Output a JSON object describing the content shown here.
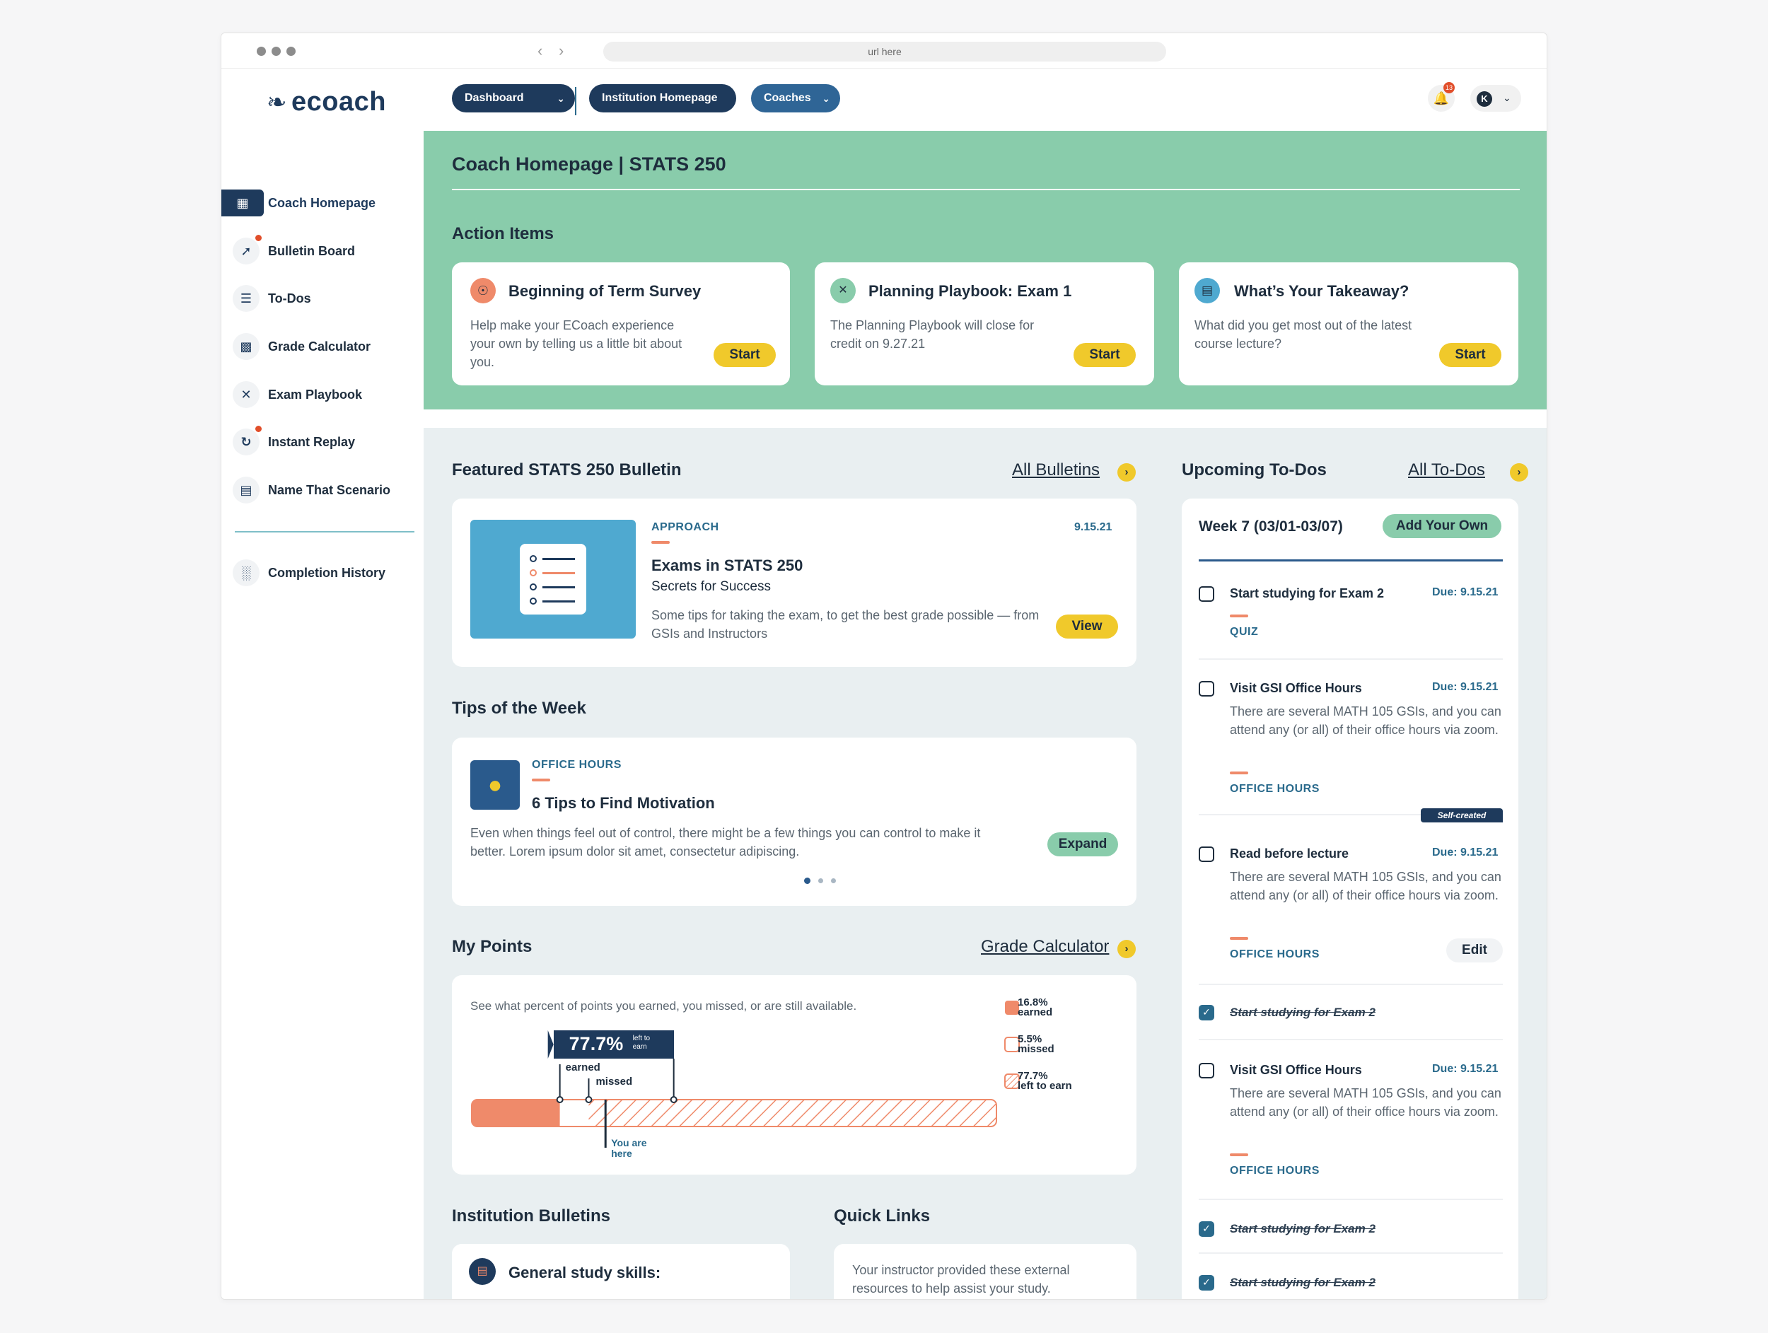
{
  "browser": {
    "url": "url here"
  },
  "logo": {
    "text": "ecoach"
  },
  "nav": {
    "dashboard": "Dashboard",
    "institution": "Institution Homepage",
    "coaches": "Coaches",
    "notification_count": "13",
    "user_initial": "K"
  },
  "sidebar": {
    "items": [
      {
        "label": "Coach Homepage",
        "icon": "dashboard-icon"
      },
      {
        "label": "Bulletin Board",
        "icon": "pin-icon"
      },
      {
        "label": "To-Dos",
        "icon": "checklist-icon"
      },
      {
        "label": "Grade Calculator",
        "icon": "calculator-icon"
      },
      {
        "label": "Exam Playbook",
        "icon": "playbook-icon"
      },
      {
        "label": "Instant Replay",
        "icon": "replay-icon"
      },
      {
        "label": "Name That Scenario",
        "icon": "scenario-icon"
      }
    ],
    "history": "Completion History"
  },
  "page": {
    "title_prefix": "Coach Homepage | ",
    "title_course": "STATS 250"
  },
  "action_items": {
    "heading": "Action Items",
    "cards": [
      {
        "title": "Beginning of Term Survey",
        "desc": "Help make your ECoach experience your own by telling us a little bit about you.",
        "button": "Start"
      },
      {
        "title": "Planning Playbook: Exam 1",
        "desc": "The Planning Playbook will close for credit on 9.27.21",
        "button": "Start"
      },
      {
        "title": "What’s Your Takeaway?",
        "desc": "What did you get most out of the latest course lecture?",
        "button": "Start"
      }
    ]
  },
  "bulletin": {
    "heading": "Featured STATS 250 Bulletin",
    "all_link": "All Bulletins",
    "kicker": "APPROACH",
    "date": "9.15.21",
    "title": "Exams in STATS 250",
    "subtitle": "Secrets for Success",
    "desc": "Some tips for taking the exam, to get the best grade possible — from GSIs and Instructors",
    "button": "View"
  },
  "tips": {
    "heading": "Tips of the Week",
    "kicker": "OFFICE HOURS",
    "title": "6 Tips to Find Motivation",
    "desc": "Even when things feel out of control, there might be a few things you can control to make it better. Lorem ipsum dolor sit amet, consectetur adipiscing.",
    "button": "Expand"
  },
  "points": {
    "heading": "My Points",
    "link": "Grade Calculator",
    "intro": "See what percent of points you earned, you missed, or are still available.",
    "callout_value": "77.7%",
    "callout_label": "left to earn",
    "label_earned": "earned",
    "label_missed": "missed",
    "label_here": "You are here",
    "earned_pct": 16.8,
    "missed_pct": 5.5,
    "left_pct": 77.7,
    "legend": [
      {
        "value": "16.8%",
        "label": "earned"
      },
      {
        "value": "5.5%",
        "label": "missed"
      },
      {
        "value": "77.7%",
        "label": "left to earn"
      }
    ]
  },
  "inst": {
    "heading": "Institution Bulletins",
    "card_title": "General study skills:"
  },
  "quick": {
    "heading": "Quick Links",
    "desc": "Your instructor provided these external resources to help assist your study."
  },
  "todos": {
    "heading": "Upcoming To-Dos",
    "all_link": "All To-Dos",
    "week": "Week 7 (03/01-03/07)",
    "add": "Add Your Own",
    "items": [
      {
        "title": "Start studying for Exam 2",
        "due": "Due: 9.15.21",
        "tag": "QUIZ"
      },
      {
        "title": "Visit GSI Office Hours",
        "due": "Due: 9.15.21",
        "desc": "There are several MATH 105 GSIs, and you can attend any (or all) of their office hours via zoom.",
        "tag": "OFFICE HOURS"
      },
      {
        "title": "Read before lecture",
        "due": "Due: 9.15.21",
        "desc": "There are several MATH 105 GSIs, and you can attend any (or all) of their office hours via zoom.",
        "tag": "OFFICE HOURS",
        "badge": "Self-created",
        "edit": "Edit"
      },
      {
        "title": "Start studying for Exam 2"
      },
      {
        "title": "Visit GSI Office Hours",
        "due": "Due: 9.15.21",
        "desc": "There are several MATH 105 GSIs, and you can attend any (or all) of their office hours via zoom.",
        "tag": "OFFICE HOURS"
      },
      {
        "title": "Start studying for Exam 2"
      },
      {
        "title": "Start studying for Exam 2"
      }
    ]
  }
}
